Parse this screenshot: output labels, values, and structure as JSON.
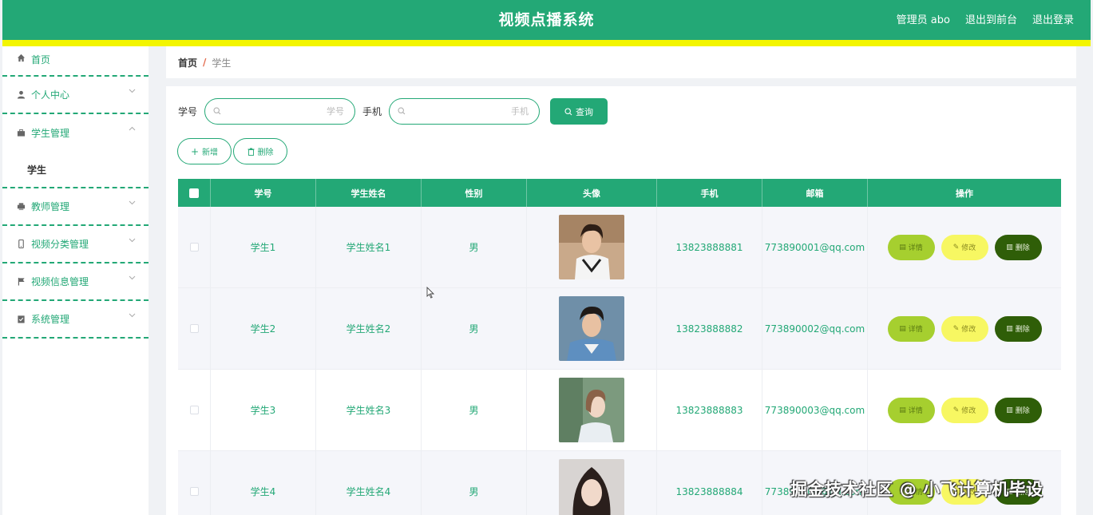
{
  "header": {
    "title": "视频点播系统",
    "admin": "管理员 abo",
    "to_front": "退出到前台",
    "logout": "退出登录"
  },
  "colors": {
    "primary": "#23a876",
    "stripe": "#f3f500",
    "detail": "#a6cf2f",
    "edit": "#f7f762",
    "delete": "#2f5e08"
  },
  "sidebar": {
    "items": [
      {
        "label": "首页",
        "icon": "home-icon"
      },
      {
        "label": "个人中心",
        "icon": "user-icon"
      },
      {
        "label": "学生管理",
        "icon": "briefcase-icon",
        "expanded": true,
        "children": [
          "学生"
        ]
      },
      {
        "label": "教师管理",
        "icon": "printer-icon"
      },
      {
        "label": "视频分类管理",
        "icon": "mobile-icon"
      },
      {
        "label": "视频信息管理",
        "icon": "flag-icon"
      },
      {
        "label": "系统管理",
        "icon": "clipboard-icon"
      }
    ]
  },
  "breadcrumb": {
    "home": "首页",
    "sep": "/",
    "current": "学生"
  },
  "search": {
    "label1": "学号",
    "placeholder1": "学号",
    "label2": "手机",
    "placeholder2": "手机",
    "button": "查询"
  },
  "actions": {
    "add": "新增",
    "delete": "删除"
  },
  "table": {
    "headers": [
      "学号",
      "学生姓名",
      "性别",
      "头像",
      "手机",
      "邮箱",
      "操作"
    ],
    "rows": [
      {
        "id": "学生1",
        "name": "学生姓名1",
        "gender": "男",
        "phone": "13823888881",
        "email": "773890001@qq.com"
      },
      {
        "id": "学生2",
        "name": "学生姓名2",
        "gender": "男",
        "phone": "13823888882",
        "email": "773890002@qq.com"
      },
      {
        "id": "学生3",
        "name": "学生姓名3",
        "gender": "男",
        "phone": "13823888883",
        "email": "773890003@qq.com"
      },
      {
        "id": "学生4",
        "name": "学生姓名4",
        "gender": "男",
        "phone": "13823888884",
        "email": "773890004@qq.com"
      }
    ],
    "ops": {
      "detail": "详情",
      "edit": "修改",
      "delete": "删除"
    }
  },
  "watermark": "掘金技术社区 @ 小飞计算机毕设"
}
